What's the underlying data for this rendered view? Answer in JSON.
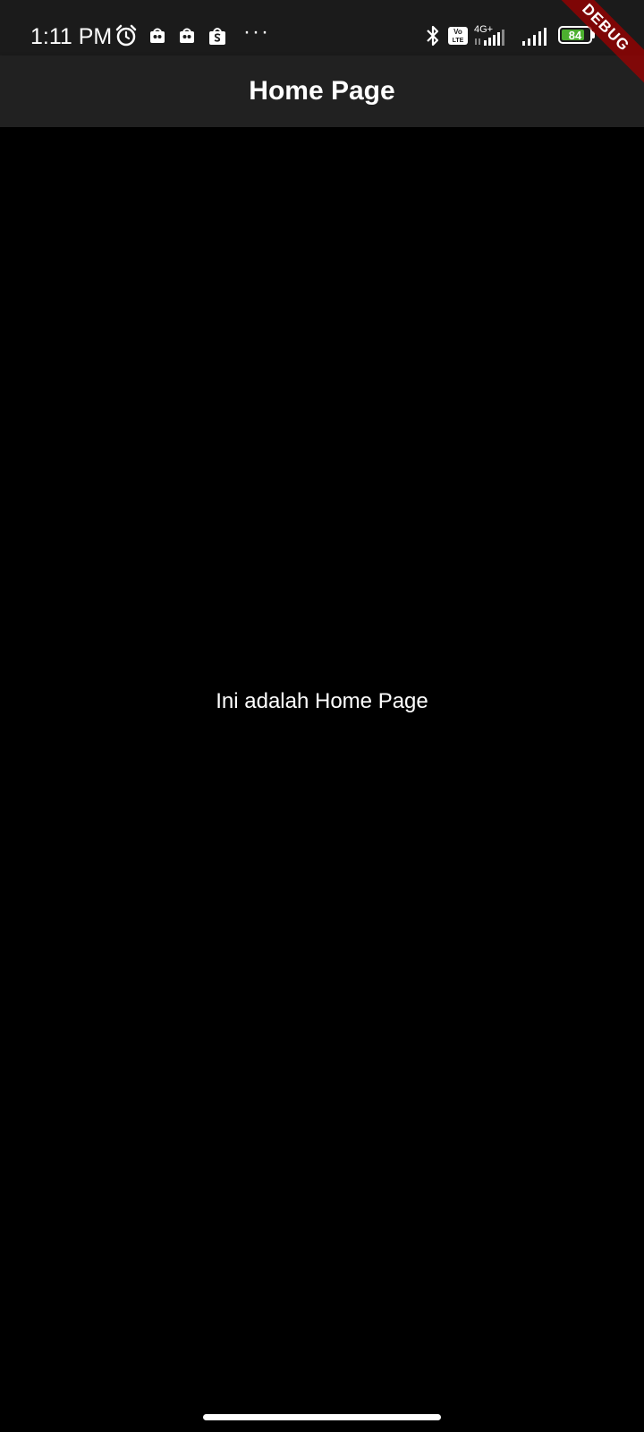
{
  "status_bar": {
    "time": "1:11 PM",
    "more": "···",
    "battery_level": "84",
    "battery_fraction": 0.84,
    "network": "4G+",
    "volte_top": "Vo",
    "volte_bottom": "LTE",
    "icons": [
      "alarm-icon",
      "notification-app-icon",
      "notification-app-icon",
      "shopee-icon",
      "bluetooth-icon",
      "volte-icon",
      "signal-icon",
      "signal-icon",
      "battery-icon"
    ],
    "battery_color": "#4caf2f"
  },
  "app_bar": {
    "title": "Home Page",
    "background": "#212121"
  },
  "body": {
    "text": "Ini adalah Home Page",
    "background": "#000000"
  },
  "debug_banner": {
    "label": "DEBUG"
  }
}
